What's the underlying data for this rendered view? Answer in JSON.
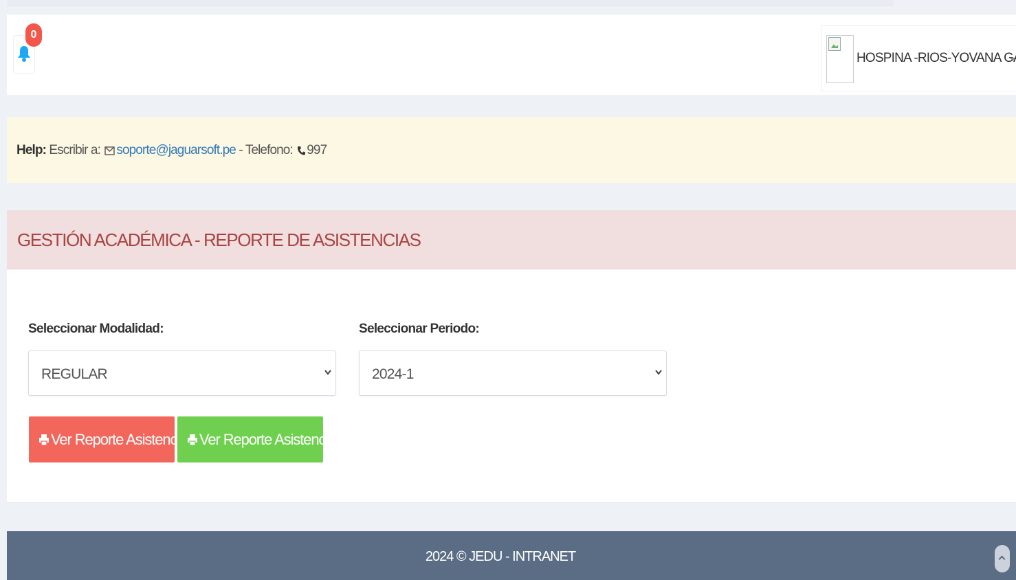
{
  "notifications": {
    "count": "0"
  },
  "user": {
    "name": "HOSPINA -RIOS-YOVANA GAVINA"
  },
  "help": {
    "label": "Help:",
    "write_to": "Escribir a:",
    "email": "soporte@jaguarsoft.pe",
    "phone_label": "- Telefono:",
    "phone": "997"
  },
  "page": {
    "title": "GESTIÓN ACADÉMICA - REPORTE DE ASISTENCIAS"
  },
  "form": {
    "modalidad_label": "Seleccionar Modalidad:",
    "modalidad_value": "REGULAR",
    "periodo_label": "Seleccionar Periodo:",
    "periodo_value": "2024-1"
  },
  "buttons": {
    "report_red": "Ver Reporte Asistencias",
    "report_green": "Ver Reporte Asistencias"
  },
  "footer": {
    "text": "2024 © JEDU - INTRANET"
  },
  "colors": {
    "badge": "#f4564a",
    "bell": "#1ea7f5",
    "help_bg": "#fdf8e4",
    "title_bg": "#f1dedf",
    "title_text": "#a94442",
    "btn_red": "#f2665c",
    "btn_green": "#6fcf4e",
    "footer_bg": "#5b6d84"
  },
  "icons": {
    "notifications": "bell-icon",
    "email": "envelope-icon",
    "phone": "phone-icon",
    "print": "print-icon",
    "scroll_top": "chevron-up-icon",
    "select_arrow": "chevron-down-icon"
  }
}
